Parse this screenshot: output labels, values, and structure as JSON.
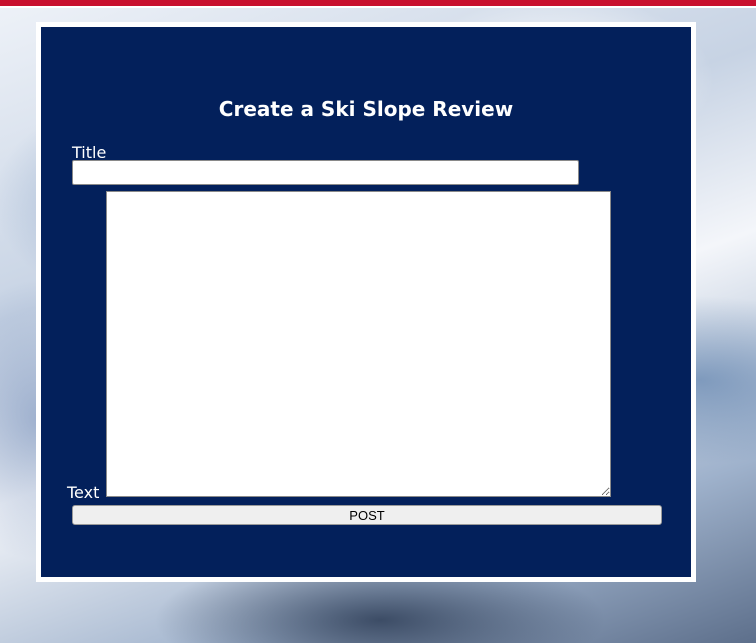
{
  "form": {
    "heading": "Create a Ski Slope Review",
    "title_label": "Title",
    "title_value": "",
    "text_label": "Text",
    "text_value": "",
    "post_label": "POST"
  },
  "colors": {
    "panel_bg": "#03205b",
    "panel_border": "#ffffff",
    "top_stripe": "#c8102e",
    "button_bg": "#efefef"
  }
}
